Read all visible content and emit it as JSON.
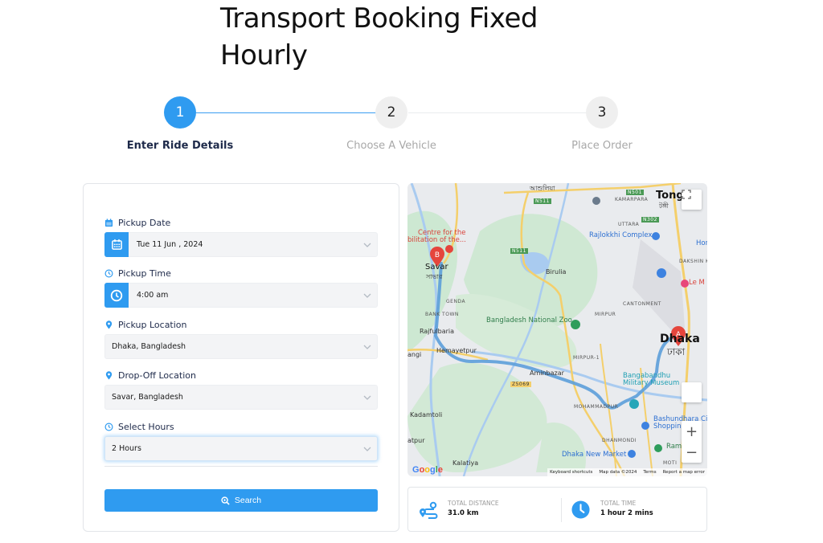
{
  "page": {
    "title": "Transport Booking Fixed Hourly"
  },
  "stepper": {
    "steps": [
      {
        "number": "1",
        "label": "Enter Ride Details",
        "state": "active"
      },
      {
        "number": "2",
        "label": "Choose A Vehicle",
        "state": "inactive"
      },
      {
        "number": "3",
        "label": "Place Order",
        "state": "inactive"
      }
    ]
  },
  "form": {
    "pickup_date": {
      "label": "Pickup Date",
      "value": "Tue 11 Jun , 2024",
      "icon": "calendar-icon"
    },
    "pickup_time": {
      "label": "Pickup Time",
      "value": "4:00 am",
      "icon": "clock-icon"
    },
    "pickup_location": {
      "label": "Pickup Location",
      "value": "Dhaka, Bangladesh",
      "icon": "map-pin-icon"
    },
    "dropoff_location": {
      "label": "Drop-Off Location",
      "value": "Savar, Bangladesh",
      "icon": "map-pin-icon"
    },
    "select_hours": {
      "label": "Select Hours",
      "value": "2 Hours",
      "icon": "clock-icon"
    },
    "search_button": {
      "label": "Search",
      "icon": "search-icon"
    }
  },
  "map": {
    "markers": [
      {
        "letter": "A",
        "place": "Dhaka"
      },
      {
        "letter": "B",
        "place": "Savar"
      }
    ],
    "labels": {
      "ashulia": "আশুলিয়া",
      "kamarpara": "KAMARPARA",
      "tongi": "Tongi",
      "tongi_bn": "টঙ্গী",
      "uttara": "UTTARA",
      "n501": "N501",
      "n511a": "N511",
      "n511b": "N511",
      "n302": "N302",
      "centre": "Centre for the",
      "centre2": "bilitation of the...",
      "rajlokkhi": "Rajlokkhi Complex",
      "hor": "Hor",
      "savar": "Savar",
      "savar_bn": "সাভার",
      "birulia": "Birulia",
      "dakshin": "DAKSHIN KH",
      "le_m": "Le M",
      "genda": "GENDA",
      "cantonment": "CANTONMENT",
      "bank_town": "BANK TOWN",
      "zoo": "Bangladesh National Zoo",
      "mirpur": "MIRPUR",
      "rajfulbaria": "Rajfulbaria",
      "dhaka": "Dhaka",
      "dhaka_bn": "ঢাকা",
      "angi": "angi",
      "hemayetpur": "Hemayetpur",
      "mirpur1": "MIRPUR-1",
      "aminbazar": "Aminbazar",
      "z5069": "Z5069",
      "bangabandhu": "Bangabandhu",
      "military": "Military Museum",
      "kadamtoli": "Kadamtoli",
      "mohammadpur": "MOHAMMADPUR",
      "bashundhara": "Bashundhara City",
      "shopping": "Shopping",
      "atpur": "atpur",
      "dhanmondi": "DHANMONDI",
      "ramna": "Ramn",
      "new_market": "Dhaka New Market",
      "kalatiya": "Kalatiya",
      "motijheel": "MOTI"
    },
    "footer": {
      "google": "Google",
      "shortcuts": "Keyboard shortcuts",
      "map_data": "Map data ©2024",
      "terms": "Terms",
      "report": "Report a map error"
    },
    "controls": {
      "zoom_in": "+",
      "zoom_out": "−"
    }
  },
  "summary": {
    "distance": {
      "caption": "Total Distance",
      "value": "31.0 km"
    },
    "time": {
      "caption": "Total Time",
      "value": "1 hour 2 mins"
    }
  },
  "colors": {
    "accent": "#2f9bf0",
    "heading": "#1e2a4a",
    "inactive_step": "#a8a8a8"
  }
}
